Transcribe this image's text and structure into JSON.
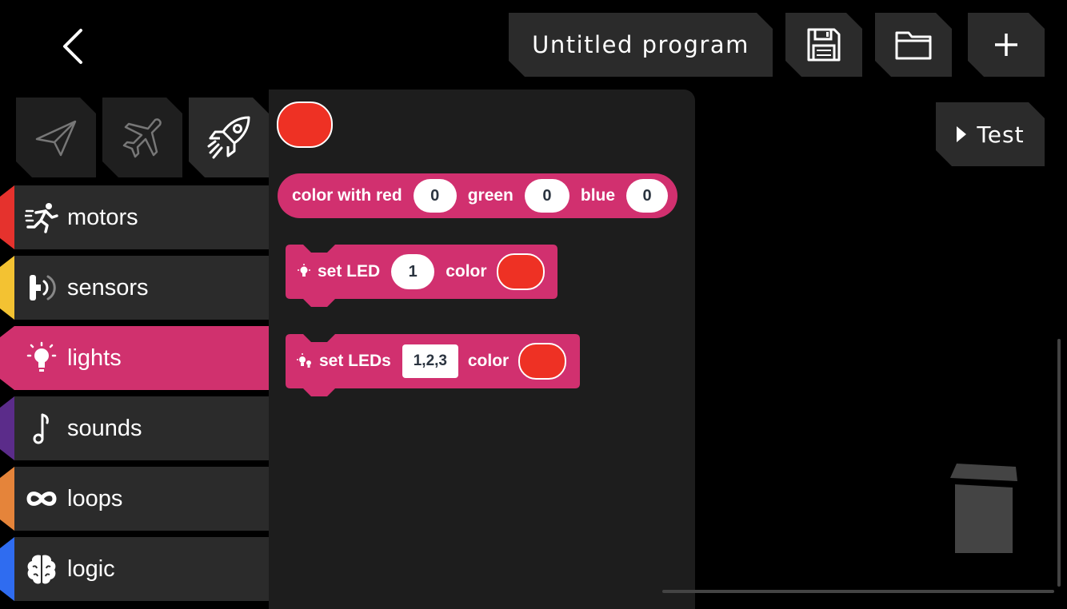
{
  "header": {
    "program_title": "Untitled program",
    "test_label": "Test"
  },
  "icons": {
    "back": "chevron-left-icon",
    "save": "floppy-disk-icon",
    "open": "folder-icon",
    "new": "plus-icon",
    "test": "play-triangle-icon",
    "trash": "trash-can-icon"
  },
  "robots": [
    {
      "icon": "paper-plane-icon",
      "active": false
    },
    {
      "icon": "airplane-icon",
      "active": false
    },
    {
      "icon": "rocket-icon",
      "active": true
    }
  ],
  "categories": [
    {
      "label": "motors",
      "color": "#e5322d",
      "icon": "running-person-icon"
    },
    {
      "label": "sensors",
      "color": "#f3c232",
      "icon": "sensor-icon"
    },
    {
      "label": "lights",
      "color": "#d0316e",
      "icon": "lightbulb-icon",
      "selected": true
    },
    {
      "label": "sounds",
      "color": "#5b2c8a",
      "icon": "music-note-icon"
    },
    {
      "label": "loops",
      "color": "#e5843a",
      "icon": "infinity-icon"
    },
    {
      "label": "logic",
      "color": "#2f6cf0",
      "icon": "brain-icon"
    }
  ],
  "blocks": {
    "color_swatch": {
      "color": "#ee3124"
    },
    "color_with": {
      "prefix": "color with red",
      "red_value": "0",
      "green_label": "green",
      "green_value": "0",
      "blue_label": "blue",
      "blue_value": "0"
    },
    "set_led": {
      "label": "set LED",
      "index": "1",
      "color_label": "color",
      "color": "#ee3124"
    },
    "set_leds": {
      "label": "set LEDs",
      "indices": "1,2,3",
      "color_label": "color",
      "color": "#ee3124"
    }
  },
  "colors": {
    "accent_pink": "#d1306f",
    "chip_bg": "#2b2b2b",
    "palette_bg": "#1d1d1d"
  }
}
